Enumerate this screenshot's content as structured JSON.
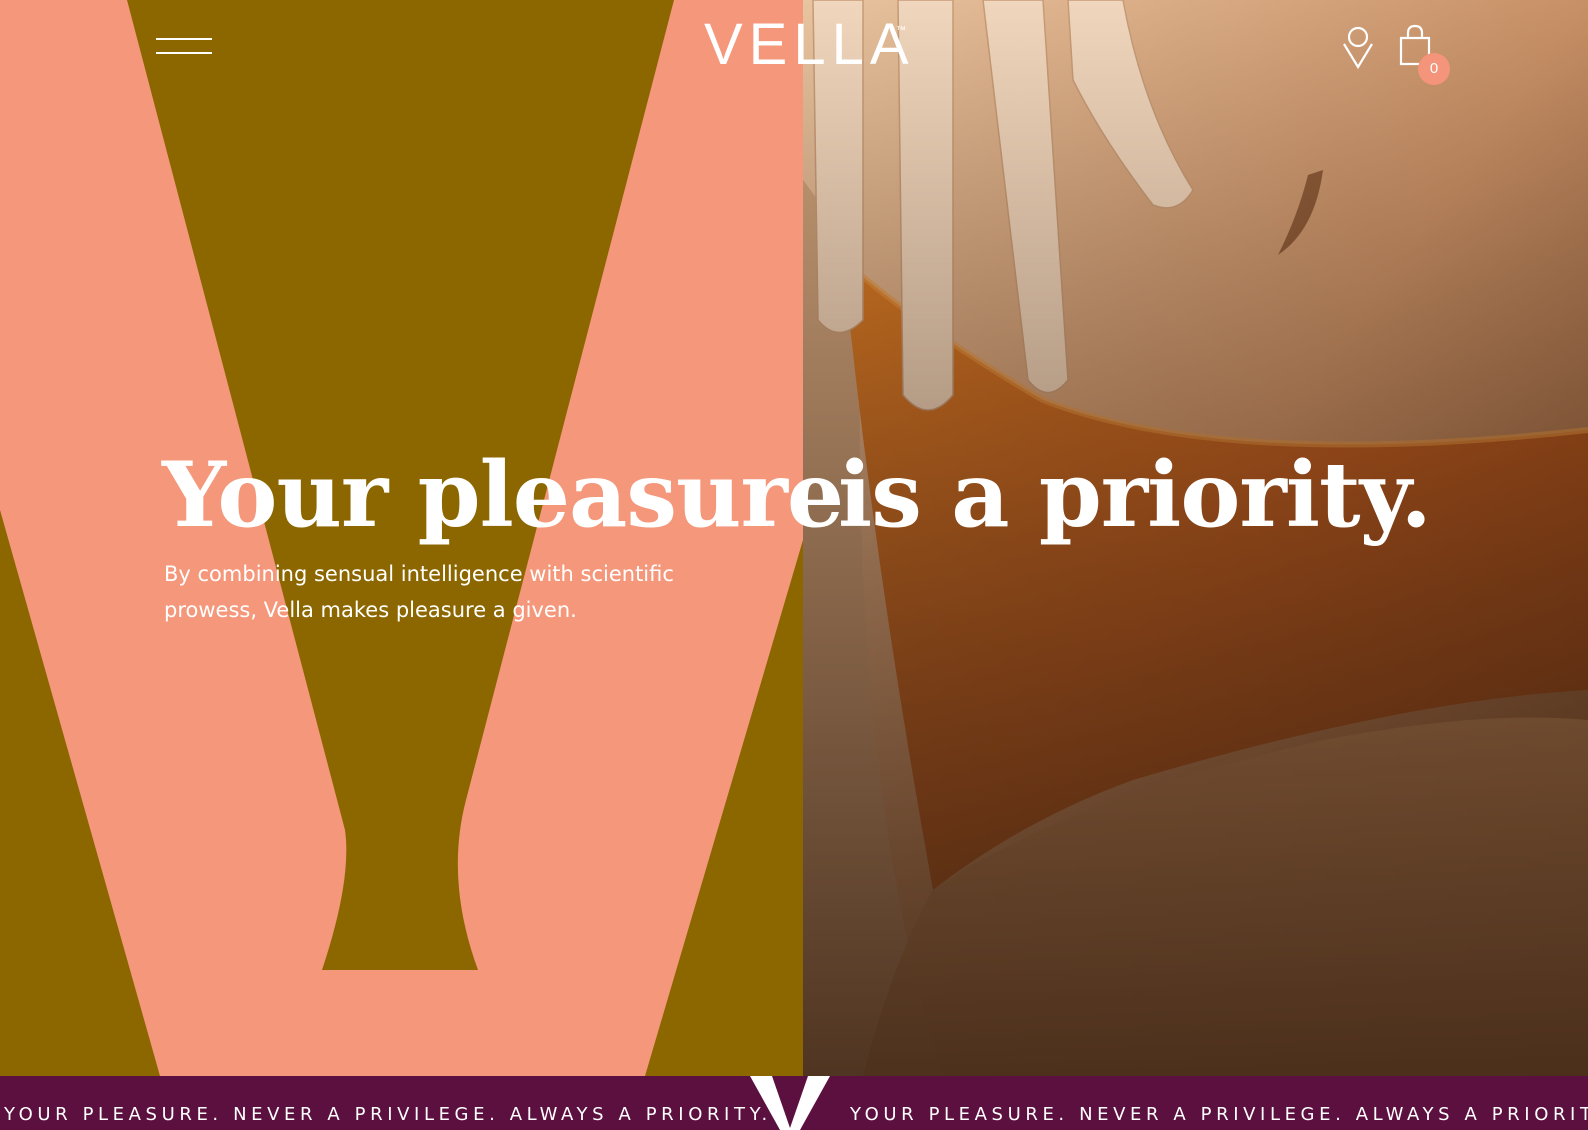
{
  "header": {
    "logo": "VELLA",
    "logo_tm": "™",
    "menu_icon": "hamburger-menu-icon",
    "location_icon": "map-pin-icon",
    "cart_icon": "shopping-bag-icon",
    "cart_count": "0"
  },
  "hero": {
    "headline_left": "Your pleasure",
    "headline_right": "is a priority.",
    "subtext": "By combining sensual intelligence with scientific prowess, Vella makes pleasure a given.",
    "left_background_color": "#8c6700",
    "v_shape_color": "#f4977a"
  },
  "ticker": {
    "text_1": "YOUR PLEASURE. NEVER A PRIVILEGE. ALWAYS A PRIORITY.",
    "text_2": "YOUR PLEASURE. NEVER A PRIVILEGE. ALWAYS A PRIORITY.",
    "background_color": "#5c1040",
    "separator_icon": "v-logo-mark-icon"
  }
}
